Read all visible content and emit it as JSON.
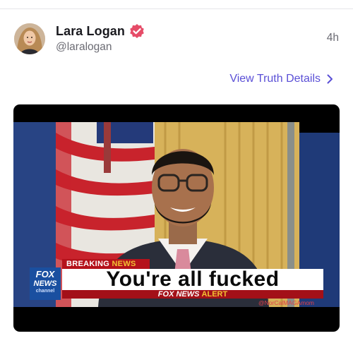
{
  "post": {
    "display_name": "Lara Logan",
    "handle": "@laralogan",
    "timestamp": "4h",
    "details_link": "View Truth Details",
    "verified_color": "#e64c68",
    "accent_color": "#5a4fd6"
  },
  "media": {
    "breaking_label": "BREAKING",
    "breaking_label_2": "NEWS",
    "headline": "You're all fucked",
    "alert_prefix": "FOX NEWS",
    "alert_suffix": "ALERT",
    "logo_line1": "FOX",
    "logo_line2": "NEWS",
    "logo_line3": "channel",
    "watermark": "@NorCalMAGAmom"
  }
}
